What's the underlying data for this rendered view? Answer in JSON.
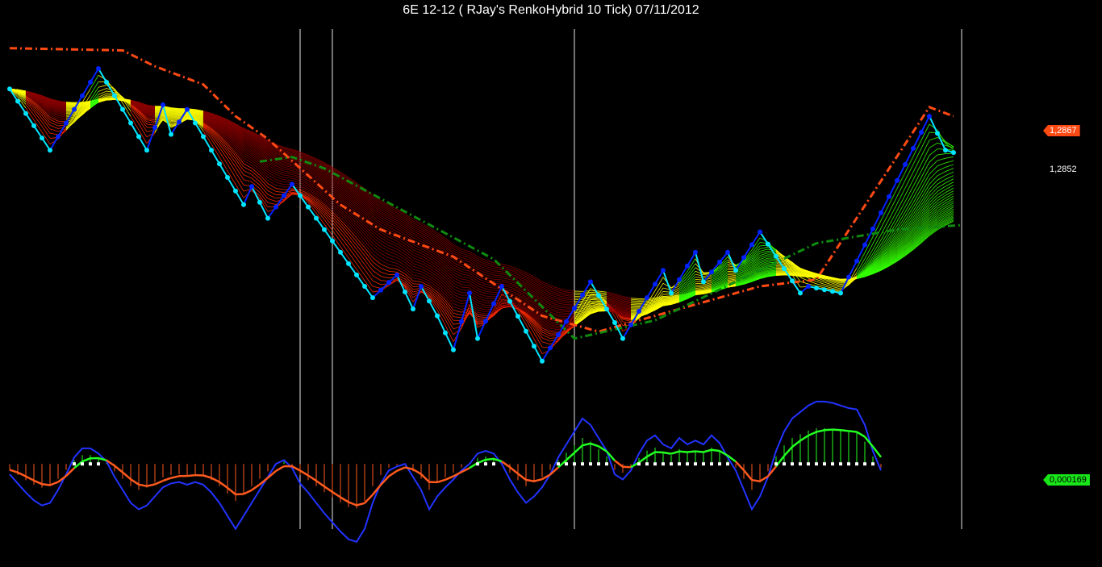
{
  "window": {
    "title": "6E 12-12 ( RJay's RenkoHybrid  10 Tick)  07/11/2012"
  },
  "price_axis": {
    "last_price_tag": "1,2867",
    "current_price_label": "1,2852",
    "oscillator_tag": "0,000169"
  },
  "colors": {
    "background": "#000000",
    "bear_ribbon_dark": "#8b0000",
    "bear_ribbon_light": "#ff2a00",
    "transition": "#ffff00",
    "bull_ribbon": "#33ff00",
    "price_swing_up": "#0022ff",
    "price_swing_down": "#00e5ff",
    "resistance_line": "#ff4a14",
    "support_line": "#0f8a0f",
    "osc_bear": "#ff5a1e",
    "osc_bull": "#22ff22",
    "osc_envelope": "#2233ff",
    "session_divider": "#ffffff"
  },
  "chart_data": [
    {
      "type": "line",
      "panel": "price",
      "title": "6E 12-12 ( RJay's RenkoHybrid  10 Tick)  07/11/2012",
      "value_range": [
        1.2745,
        1.2905
      ],
      "session_breaks": [
        36,
        40,
        70,
        118
      ],
      "last_price": 1.2867,
      "current_price": 1.2852,
      "price_swings": [
        [
          0,
          1.288
        ],
        [
          5,
          1.2853
        ],
        [
          11,
          1.2889
        ],
        [
          17,
          1.2853
        ],
        [
          19,
          1.2873
        ],
        [
          20,
          1.286
        ],
        [
          22,
          1.2871
        ],
        [
          29,
          1.2829
        ],
        [
          30,
          1.2837
        ],
        [
          32,
          1.2823
        ],
        [
          35,
          1.2838
        ],
        [
          45,
          1.2788
        ],
        [
          48,
          1.2798
        ],
        [
          50,
          1.2783
        ],
        [
          51,
          1.2793
        ],
        [
          53,
          1.278
        ],
        [
          55,
          1.2765
        ],
        [
          57,
          1.279
        ],
        [
          58,
          1.277
        ],
        [
          61,
          1.2793
        ],
        [
          66,
          1.276
        ],
        [
          72,
          1.2795
        ],
        [
          75,
          1.2777
        ],
        [
          76,
          1.277
        ],
        [
          81,
          1.28
        ],
        [
          82,
          1.279
        ],
        [
          85,
          1.2808
        ],
        [
          86,
          1.2795
        ],
        [
          89,
          1.2808
        ],
        [
          90,
          1.28
        ],
        [
          93,
          1.2817
        ],
        [
          98,
          1.279
        ],
        [
          99,
          1.2793
        ],
        [
          103,
          1.279
        ],
        [
          114,
          1.2868
        ],
        [
          116,
          1.2853
        ],
        [
          117,
          1.2852
        ]
      ],
      "resistance_line": [
        [
          0,
          1.2898
        ],
        [
          14,
          1.2897
        ],
        [
          18,
          1.289
        ],
        [
          24,
          1.2882
        ],
        [
          28,
          1.2868
        ],
        [
          32,
          1.2858
        ],
        [
          41,
          1.2829
        ],
        [
          46,
          1.2818
        ],
        [
          55,
          1.2806
        ],
        [
          66,
          1.278
        ],
        [
          73,
          1.2773
        ],
        [
          78,
          1.2778
        ],
        [
          93,
          1.2793
        ],
        [
          100,
          1.2796
        ],
        [
          114,
          1.2872
        ],
        [
          117,
          1.2868
        ]
      ],
      "support_line": [
        [
          31,
          1.2848
        ],
        [
          35,
          1.285
        ],
        [
          39,
          1.2845
        ],
        [
          60,
          1.2805
        ],
        [
          70,
          1.277
        ],
        [
          80,
          1.2778
        ],
        [
          90,
          1.2795
        ],
        [
          100,
          1.2812
        ],
        [
          110,
          1.2818
        ],
        [
          118,
          1.282
        ]
      ]
    },
    {
      "type": "bar",
      "panel": "oscillator",
      "value_range": [
        -0.0009,
        0.0006
      ],
      "current_value": 0.000169,
      "series": [
        {
          "values": [
            -8e-05,
            -0.00015,
            -0.00022,
            -0.00028,
            -0.00032,
            -0.0003,
            -0.0002,
            -8e-05,
            5e-05,
            0.00012,
            0.00012,
            8e-05,
            2e-05,
            -0.0001,
            -0.0002,
            -0.0003,
            -0.00035,
            -0.00032,
            -0.00025,
            -0.00018,
            -0.00015,
            -0.00014,
            -0.00016,
            -0.00014,
            -0.00016,
            -0.00022,
            -0.0003,
            -0.0004,
            -0.0005,
            -0.0004,
            -0.0003,
            -0.0002,
            -0.0001,
            0.0,
            3e-05,
            -3e-05,
            -0.00015,
            -0.00022,
            -0.0003,
            -0.00038,
            -0.00045,
            -0.00052,
            -0.00058,
            -0.0006,
            -0.0005,
            -0.0003,
            -0.00015,
            -5e-05,
            -2e-05,
            0.0,
            -0.0001,
            -0.0002,
            -0.00035,
            -0.00025,
            -0.00018,
            -0.00012,
            -5e-05,
            0.0,
            8e-05,
            0.0001,
            8e-05,
            0.0,
            -0.00012,
            -0.00022,
            -0.0003,
            -0.00025,
            -0.00018,
            -8e-05,
            5e-05,
            0.00015,
            0.00025,
            0.00035,
            0.0003,
            0.0002,
            0.0001,
            -8e-05,
            -0.00012,
            -5e-05,
            8e-05,
            0.00018,
            0.00022,
            0.00015,
            0.00012,
            0.0002,
            0.00015,
            0.00018,
            0.00015,
            0.00022,
            0.00016,
            5e-05,
            -5e-05,
            -0.0002,
            -0.00035,
            -0.00025,
            -0.0001,
            0.0001,
            0.00025,
            0.00035,
            0.0004,
            0.00045,
            0.00048,
            0.00048,
            0.00047,
            0.00045,
            0.00043,
            0.00042,
            0.0003,
            0.0001,
            -5e-05
          ]
        }
      ]
    }
  ]
}
